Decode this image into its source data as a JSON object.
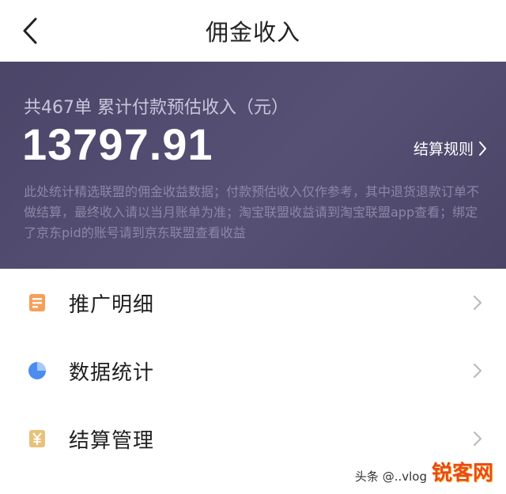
{
  "header": {
    "title": "佣金收入",
    "back_icon": "chevron-left-icon"
  },
  "summary": {
    "caption": "共467单 累计付款预估收入（元）",
    "amount": "13797.91",
    "rules_label": "结算规则",
    "rules_icon": "chevron-right-icon",
    "note": "此处统计精选联盟的佣金收益数据；付款预估收入仅作参考，其中退货退款订单不做结算，最终收入请以当月账单为准；淘宝联盟收益请到淘宝联盟app查看；绑定了京东pid的账号请到京东联盟查看收益"
  },
  "menu": {
    "items": [
      {
        "label": "推广明细",
        "icon": "document-icon",
        "icon_color": "#f5a05a"
      },
      {
        "label": "数据统计",
        "icon": "pie-chart-icon",
        "icon_color": "#4a8cf0"
      },
      {
        "label": "结算管理",
        "icon": "yen-icon",
        "icon_color": "#e8c27a"
      }
    ]
  },
  "watermark": {
    "logo": "锐客网",
    "credit": "头条 @..vlog"
  },
  "colors": {
    "card_bg": "#4f4a6e",
    "text_dark": "#1f1f1f",
    "arrow": "#bbbbbb"
  }
}
